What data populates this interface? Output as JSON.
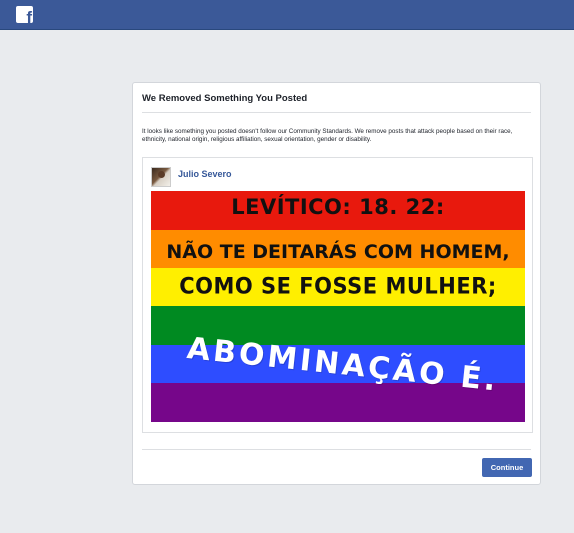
{
  "header": {
    "logo_icon": "facebook-f-icon",
    "logo_letter": "f",
    "background_color": "#3b5998"
  },
  "dialog": {
    "title": "We Removed Something You Posted",
    "body": "It looks like something you posted doesn't follow our Community Standards. We remove posts that attack people based on their race, ethnicity, national origin, religious affiliation, sexual orientation, gender or disability.",
    "continue_label": "Continue",
    "button_color": "#4267b2"
  },
  "post": {
    "author_name": "Julio Severo",
    "author_color": "#365899",
    "image": {
      "stripe_colors": [
        "#e8190d",
        "#ff8c00",
        "#ffef00",
        "#008a21",
        "#2e4dff",
        "#76068a"
      ],
      "line1": "LEVÍTICO: 18. 22:",
      "line2": "NÃO TE DEITARÁS COM HOMEM,",
      "line3": "COMO SE FOSSE MULHER;",
      "line4": "ABOMINAÇÃO É."
    }
  }
}
